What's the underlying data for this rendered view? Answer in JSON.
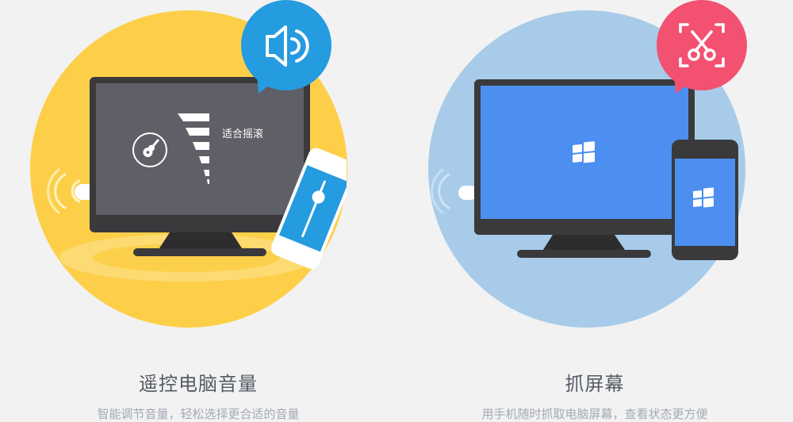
{
  "features": [
    {
      "title": "遥控电脑音量",
      "description": "智能调节音量，轻松选择更合适的音量",
      "screen_label": "适合摇滚",
      "icons": [
        "speaker-icon",
        "guitar-icon",
        "volume-level-icon",
        "volume-slider-icon"
      ],
      "colors": {
        "circle": "#fdcf49",
        "bubble": "#259be0",
        "screen": "#5f5f67"
      }
    },
    {
      "title": "抓屏幕",
      "description": "用手机随时抓取电脑屏幕，查看状态更方便",
      "icons": [
        "screenshot-scissors-icon",
        "windows-logo-icon"
      ],
      "colors": {
        "circle": "#a7cbe9",
        "bubble": "#f25172",
        "screen": "#4c8ff0"
      }
    }
  ]
}
